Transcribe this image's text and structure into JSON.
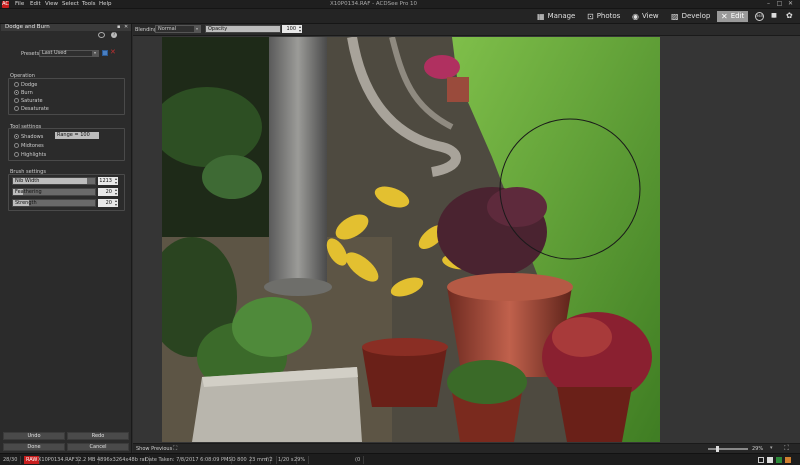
{
  "app": {
    "title": "X10P0134.RAF - ACDSee Pro 10",
    "logo": "AC",
    "menu": [
      "File",
      "Edit",
      "View",
      "Select",
      "Tools",
      "Help"
    ],
    "window_controls": {
      "minimize": "–",
      "maximize": "□",
      "close": "✕"
    }
  },
  "modes": [
    {
      "label": "Manage",
      "icon": "manage-icon",
      "glyph": "▦"
    },
    {
      "label": "Photos",
      "icon": "photos-icon",
      "glyph": "⊡"
    },
    {
      "label": "View",
      "icon": "view-icon",
      "glyph": "◉"
    },
    {
      "label": "Develop",
      "icon": "develop-icon",
      "glyph": "▨"
    },
    {
      "label": "Edit",
      "icon": "edit-icon",
      "glyph": "✕",
      "active": true
    }
  ],
  "toolbar_right": {
    "badge": "365",
    "histogram": "▮▮▮",
    "palette": "✿"
  },
  "panel": {
    "title": "Dodge and Burn",
    "pin": "▪",
    "close": "✕",
    "presets_label": "Presets",
    "presets_value": "Last Used",
    "operation": {
      "title": "Operation",
      "options": [
        "Dodge",
        "Burn",
        "Saturate",
        "Desaturate"
      ],
      "selected": "Burn"
    },
    "tool_settings": {
      "title": "Tool settings",
      "options": [
        "Shadows",
        "Midtones",
        "Highlights"
      ],
      "selected": "Shadows",
      "range_label": "Range = 100"
    },
    "brush_settings": {
      "title": "Brush settings",
      "sliders": [
        {
          "label": "Nib Width",
          "value": "1213",
          "fill": 0.9
        },
        {
          "label": "Feathering",
          "value": "20",
          "fill": 0.12
        },
        {
          "label": "Strength",
          "value": "20",
          "fill": 0.2
        }
      ]
    },
    "buttons": {
      "undo": "Undo",
      "redo": "Redo",
      "done": "Done",
      "cancel": "Cancel"
    }
  },
  "canvas_bar": {
    "blending_label": "Blending:",
    "blending_value": "Normal",
    "opacity_label": "Opacity",
    "opacity_value": "100"
  },
  "bottom_bar": {
    "show_previous": "Show Previous",
    "zoom_value": "29%"
  },
  "status": [
    "28/30",
    "RAW",
    "X10P0134.RAF",
    "32.2 MB",
    "4896x3264x48b raf",
    "Date Taken: 7/8/2017 6:08:09 PM",
    "ISO 800",
    "23 mm",
    "f/2",
    "1/20 s",
    "29%",
    "(0"
  ],
  "colors": {
    "accent_active": "#9a9a9a",
    "raw_badge": "#c81e1e"
  }
}
